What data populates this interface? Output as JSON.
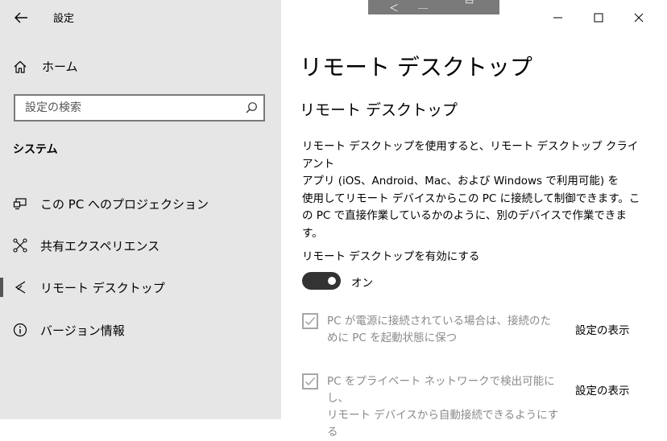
{
  "window": {
    "title": "設定",
    "controls": {
      "minimize": "minimize-icon",
      "maximize": "maximize-icon",
      "close": "close-icon"
    }
  },
  "sidebar": {
    "home_label": "ホーム",
    "search_placeholder": "設定の検索",
    "section_label": "システム",
    "items": [
      {
        "label": "この PC へのプロジェクション",
        "icon": "projection-icon",
        "active": false
      },
      {
        "label": "共有エクスペリエンス",
        "icon": "shared-experiences-icon",
        "active": false
      },
      {
        "label": "リモート デスクトップ",
        "icon": "remote-desktop-icon",
        "active": true
      },
      {
        "label": "バージョン情報",
        "icon": "info-icon",
        "active": false
      }
    ]
  },
  "main": {
    "page_title": "リモート デスクトップ",
    "section_title": "リモート デスクトップ",
    "description_lines": [
      "リモート デスクトップを使用すると、リモート デスクトップ クライアント",
      "アプリ (iOS、Android、Mac、および Windows で利用可能) を",
      "使用してリモート デバイスからこの PC に接続して制御できます。こ",
      "の PC で直接作業しているかのように、別のデバイスで作業できま",
      "す。"
    ],
    "enable_label": "リモート デスクトップを有効にする",
    "toggle": {
      "state_label": "オン",
      "on": true
    },
    "options": [
      {
        "line1": "PC が電源に接続されている場合は、接続のた",
        "line2": "めに PC を起動状態に保つ",
        "checked": true,
        "link": "設定の表示"
      },
      {
        "line1": "PC をプライベート ネットワークで検出可能にし、",
        "line2": "リモート デバイスから自動接続できるようにする",
        "checked": true,
        "link": "設定の表示"
      }
    ]
  },
  "colors": {
    "sidebar_bg": "#e6e6e6",
    "toggle_on": "#333333",
    "disabled_text": "#8a8a8a",
    "checkbox_disabled": "#a6a6a6"
  }
}
